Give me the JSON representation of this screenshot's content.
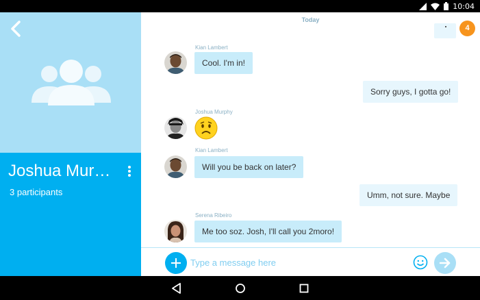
{
  "status_bar": {
    "time": "10:04",
    "icons": [
      "signal-icon",
      "wifi-icon",
      "battery-icon"
    ]
  },
  "conversation": {
    "title": "Joshua Mur…",
    "participants": "3 participants"
  },
  "chat": {
    "date_separator": "Today",
    "unread_count": "4",
    "messages": [
      {
        "direction": "in",
        "sender": "Kian Lambert",
        "text": "Cool. I'm in!"
      },
      {
        "direction": "out",
        "text": "Sorry guys, I gotta go!"
      },
      {
        "direction": "in",
        "sender": "Joshua Murphy",
        "emoticon": "sad-emoticon"
      },
      {
        "direction": "in",
        "sender": "Kian Lambert",
        "text": "Will you be back on later?"
      },
      {
        "direction": "out",
        "text": "Umm, not sure. Maybe"
      },
      {
        "direction": "in",
        "sender": "Serena Ribeiro",
        "text": "Me too soz. Josh, I'll call you 2moro!"
      }
    ]
  },
  "composer": {
    "placeholder": "Type a message here"
  },
  "colors": {
    "brand": "#00aff0",
    "panel_light": "#a9dff6",
    "bubble_in": "#c8ecfa",
    "bubble_out": "#e7f6fd",
    "badge": "#f7941d"
  }
}
